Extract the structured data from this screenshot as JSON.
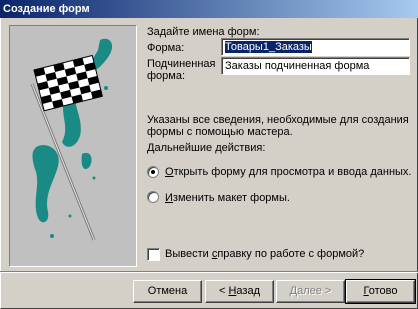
{
  "window": {
    "title": "Создание форм"
  },
  "form": {
    "heading": "Задайте имена форм:",
    "form_label": "Форма:",
    "form_value": "Товары1_Заказы",
    "subform_label_line1": "Подчиненная",
    "subform_label_line2": "форма:",
    "subform_value": "Заказы подчиненная форма"
  },
  "info": {
    "line1": "Указаны все сведения, необходимые для создания",
    "line2": "формы с помощью мастера.",
    "next_actions": "Дальнейшие действия:"
  },
  "options": [
    {
      "mnemonic": "О",
      "rest": "ткрыть форму для просмотра и ввода данных.",
      "checked": true
    },
    {
      "mnemonic": "И",
      "rest": "зменить макет формы.",
      "checked": false
    }
  ],
  "help_checkbox": {
    "pre": "Вывести ",
    "mnemonic": "с",
    "rest": "правку по работе с формой?",
    "checked": false
  },
  "buttons": {
    "cancel": "Отмена",
    "back_pre": "< ",
    "back_mn": "Н",
    "back_rest": "азад",
    "next_mn": "Д",
    "next_rest": "алее >",
    "finish_mn": "Г",
    "finish_rest": "отово"
  },
  "colors": {
    "titlebar": "#0a246a",
    "dialog_bg": "#d4d0c8",
    "flag_teal": "#1a8a84"
  }
}
